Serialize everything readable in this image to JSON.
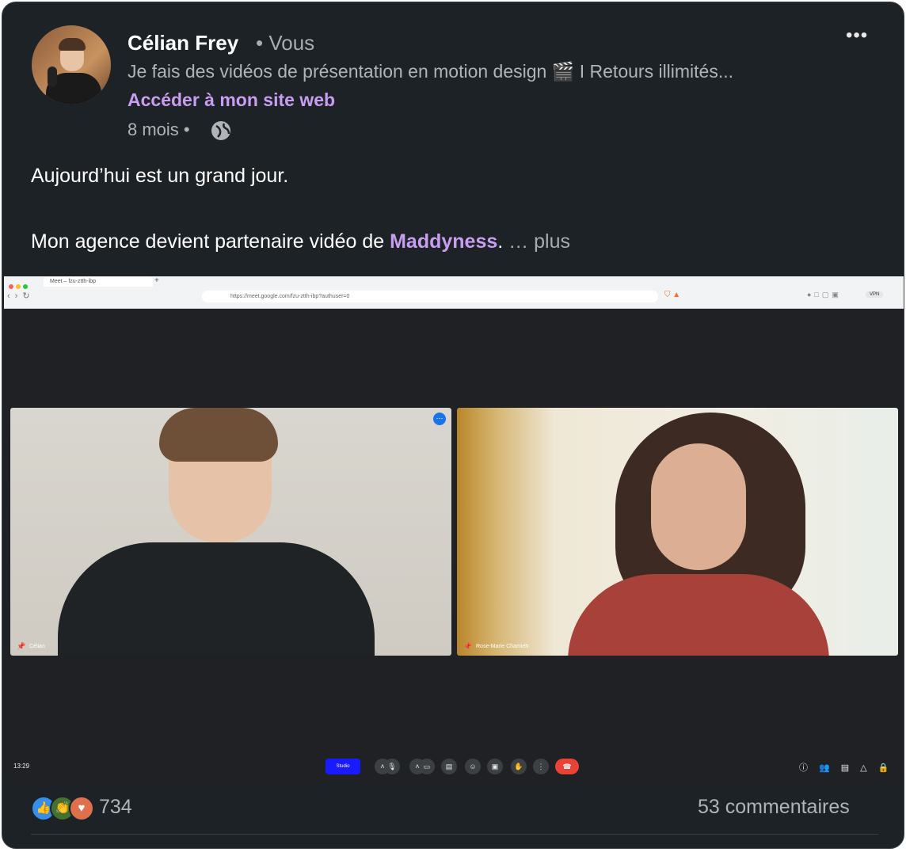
{
  "post": {
    "author": "Célian Frey",
    "relation": "• Vous",
    "headline": "Je fais des vidéos de présentation en motion design 🎬 I Retours illimités...",
    "site_link": "Accéder à mon site web",
    "age": "8 mois •",
    "visibility_icon": "globe-icon",
    "more_label": "•••",
    "line1": "Aujourd’hui est un grand jour.",
    "line2_prefix": "Mon agence devient partenaire vidéo de ",
    "mention": "Maddyness",
    "line2_suffix": ".",
    "see_more": "… plus"
  },
  "screenshot": {
    "tab_title": "Meet – fzu-ztth-ibp",
    "url": "https://meet.google.com/fzu-ztth-ibp?authuser=0",
    "vpn": "VPN",
    "tile1_name": "Célian",
    "tile2_name": "Rose-Marie Chamieh",
    "clock": "13:29",
    "participants_count": "2",
    "blue_button": "Studio"
  },
  "footer": {
    "reaction_count": "734",
    "comments": "53 commentaires",
    "reaction_icons": [
      "like-icon",
      "celebrate-icon",
      "love-icon"
    ]
  },
  "colors": {
    "background": "#1d2226",
    "accent": "#c99ef0",
    "end_call": "#ea4335"
  }
}
